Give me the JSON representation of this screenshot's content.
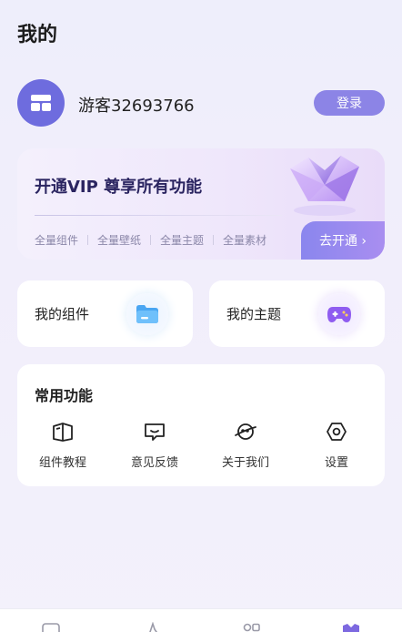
{
  "header": {
    "title": "我的"
  },
  "profile": {
    "username": "游客32693766",
    "login_label": "登录"
  },
  "vip": {
    "title": "开通VIP 尊享所有功能",
    "features": [
      "全量组件",
      "全量壁纸",
      "全量主题",
      "全量素材"
    ],
    "open_label": "去开通 ›"
  },
  "quick_cards": {
    "widgets": {
      "label": "我的组件",
      "icon": "folder-icon"
    },
    "themes": {
      "label": "我的主题",
      "icon": "gamepad-icon"
    }
  },
  "functions": {
    "title": "常用功能",
    "items": [
      {
        "label": "组件教程",
        "icon": "book-icon"
      },
      {
        "label": "意见反馈",
        "icon": "feedback-icon"
      },
      {
        "label": "关于我们",
        "icon": "planet-icon"
      },
      {
        "label": "设置",
        "icon": "settings-icon"
      }
    ]
  },
  "colors": {
    "accent": "#8c84e6",
    "avatar": "#6e6cde",
    "vip_text": "#2a2460"
  }
}
